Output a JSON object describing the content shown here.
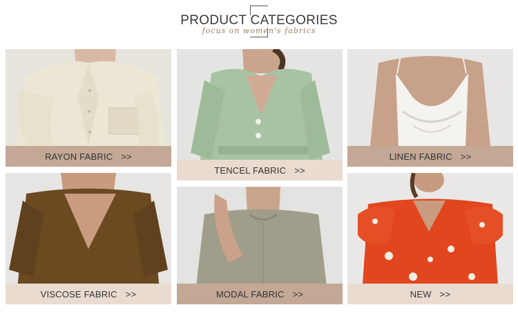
{
  "header": {
    "title": "PRODUCT CATEGORIES",
    "subtitle": "focus on women's fabrics"
  },
  "categories": [
    {
      "label": "RAYON FABRIC",
      "arrow": ">>"
    },
    {
      "label": "TENCEL FABRIC",
      "arrow": ">>"
    },
    {
      "label": "LINEN FABRIC",
      "arrow": ">>"
    },
    {
      "label": "VISCOSE FABRIC",
      "arrow": ">>"
    },
    {
      "label": "MODAL FABRIC",
      "arrow": ">>"
    },
    {
      "label": "NEW",
      "arrow": ">>"
    }
  ]
}
